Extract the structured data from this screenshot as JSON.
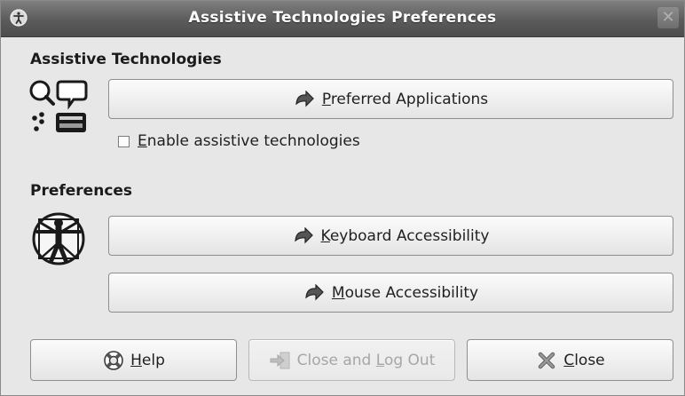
{
  "window": {
    "title": "Assistive Technologies Preferences",
    "close_glyph": "✕"
  },
  "assistive": {
    "heading": "Assistive Technologies",
    "preferred_button": {
      "mnemonic": "P",
      "rest": "referred Applications",
      "icon": "jump-arrow-icon"
    },
    "checkbox": {
      "mnemonic": "E",
      "rest": "nable assistive technologies",
      "checked": false
    }
  },
  "preferences": {
    "heading": "Preferences",
    "keyboard_button": {
      "mnemonic": "K",
      "rest": "eyboard Accessibility",
      "icon": "jump-arrow-icon"
    },
    "mouse_button": {
      "mnemonic": "M",
      "rest": "ouse Accessibility",
      "icon": "jump-arrow-icon"
    }
  },
  "footer": {
    "help_button": {
      "mnemonic": "H",
      "rest": "elp",
      "icon": "lifebuoy-icon"
    },
    "logout_button": {
      "before": "Close and ",
      "mnemonic": "L",
      "rest": "og Out",
      "icon": "logout-icon",
      "enabled": false
    },
    "close_button": {
      "mnemonic": "C",
      "rest": "lose",
      "icon": "close-x-icon"
    }
  }
}
